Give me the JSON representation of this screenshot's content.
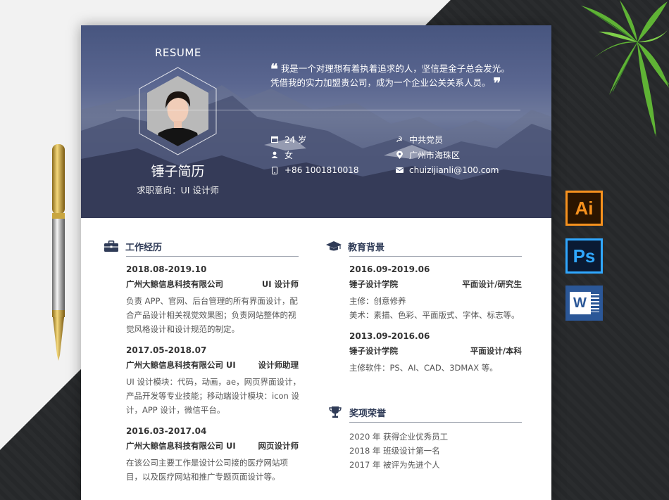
{
  "header": {
    "resume_label": "RESUME",
    "name": "锤子简历",
    "intent": "求职意向：UI 设计师",
    "quote_line1": "我是一个对理想有着执着追求的人，坚信是金子总会发光。",
    "quote_line2": "凭借我的实力加盟贵公司，成为一个企业公关关系人员。",
    "info": {
      "age": "24 岁",
      "gender": "女",
      "phone": "+86 1001810018",
      "politics": "中共党员",
      "location": "广州市海珠区",
      "email": "chuizijianli@100.com"
    }
  },
  "work": {
    "title": "工作经历",
    "items": [
      {
        "date": "2018.08-2019.10",
        "company": "广州大鲸信息科技有限公司",
        "role": "UI 设计师",
        "desc": [
          "负责 APP、官网、后台管理的所有界面设计，配",
          "合产品设计相关视觉效果图；负责网站整体的视",
          "觉风格设计和设计规范的制定。"
        ]
      },
      {
        "date": "2017.05-2018.07",
        "company": "广州大鲸信息科技有限公司 UI",
        "role": "设计师助理",
        "desc": [
          "UI 设计模块：代码，动画，ae，网页界面设计，",
          "产品开发等专业技能；移动端设计模块：icon 设",
          "计，APP 设计，微信平台。"
        ]
      },
      {
        "date": "2016.03-2017.04",
        "company": "广州大鲸信息科技有限公司 UI",
        "role": "网页设计师",
        "desc": [
          "在该公司主要工作是设计公司接的医疗网站项",
          "目，以及医疗网站和推广专题页面设计等。"
        ]
      }
    ]
  },
  "education": {
    "title": "教育背景",
    "items": [
      {
        "date": "2016.09-2019.06",
        "school": "锤子设计学院",
        "degree": "平面设计/研究生",
        "desc": [
          "主修：创意修养",
          "美术：素描、色彩、平面版式、字体、标志等。"
        ]
      },
      {
        "date": "2013.09-2016.06",
        "school": "锤子设计学院",
        "degree": "平面设计/本科",
        "desc": [
          "主修软件：PS、AI、CAD、3DMAX 等。"
        ]
      }
    ]
  },
  "awards": {
    "title": "奖项荣誉",
    "items": [
      "2020 年  获得企业优秀员工",
      "2018 年  班级设计第一名",
      "2017 年  被评为先进个人"
    ]
  },
  "apps": {
    "ai": "Ai",
    "ps": "Ps",
    "word": "W"
  },
  "colors": {
    "heading": "#2f3b57",
    "banner": "#47557f",
    "ai": "#f7921e",
    "ps": "#30a8ff",
    "word": "#2b5797"
  }
}
